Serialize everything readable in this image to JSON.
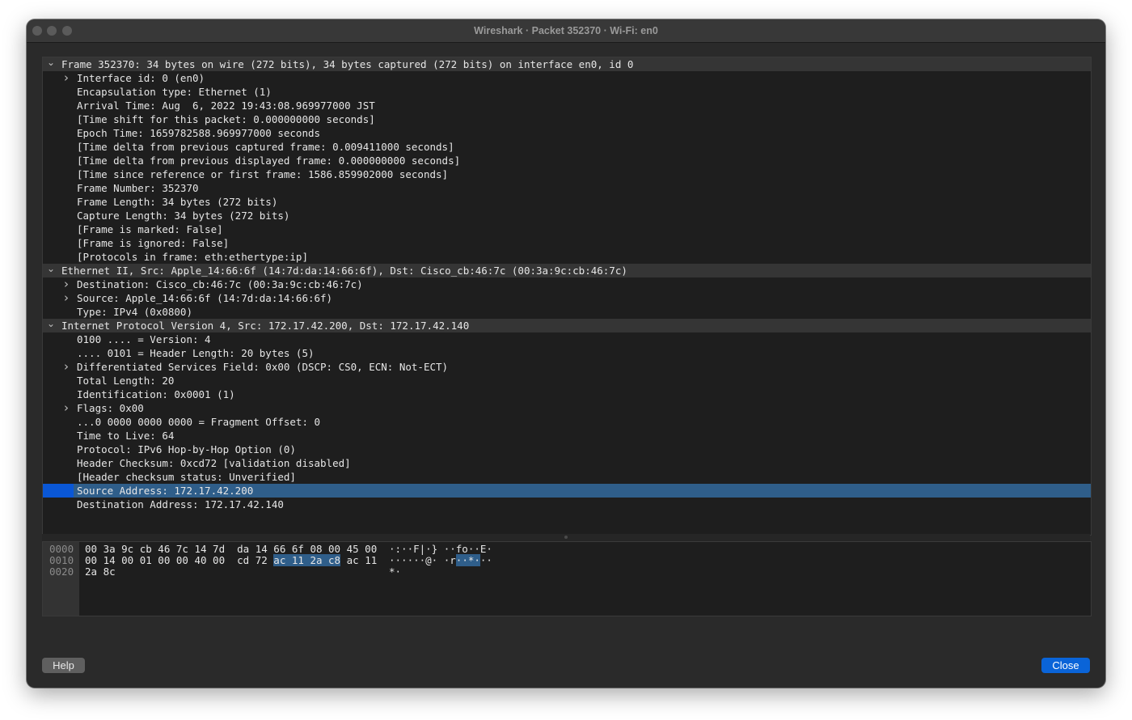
{
  "window": {
    "title": "Wireshark · Packet 352370 · Wi-Fi: en0"
  },
  "tree": {
    "rows": [
      {
        "level": 0,
        "arrow": "expanded",
        "section": true,
        "text": "Frame 352370: 34 bytes on wire (272 bits), 34 bytes captured (272 bits) on interface en0, id 0"
      },
      {
        "level": 1,
        "arrow": "collapsed",
        "text": "Interface id: 0 (en0)"
      },
      {
        "level": 1,
        "arrow": "none",
        "text": "Encapsulation type: Ethernet (1)"
      },
      {
        "level": 1,
        "arrow": "none",
        "text": "Arrival Time: Aug  6, 2022 19:43:08.969977000 JST"
      },
      {
        "level": 1,
        "arrow": "none",
        "text": "[Time shift for this packet: 0.000000000 seconds]"
      },
      {
        "level": 1,
        "arrow": "none",
        "text": "Epoch Time: 1659782588.969977000 seconds"
      },
      {
        "level": 1,
        "arrow": "none",
        "text": "[Time delta from previous captured frame: 0.009411000 seconds]"
      },
      {
        "level": 1,
        "arrow": "none",
        "text": "[Time delta from previous displayed frame: 0.000000000 seconds]"
      },
      {
        "level": 1,
        "arrow": "none",
        "text": "[Time since reference or first frame: 1586.859902000 seconds]"
      },
      {
        "level": 1,
        "arrow": "none",
        "text": "Frame Number: 352370"
      },
      {
        "level": 1,
        "arrow": "none",
        "text": "Frame Length: 34 bytes (272 bits)"
      },
      {
        "level": 1,
        "arrow": "none",
        "text": "Capture Length: 34 bytes (272 bits)"
      },
      {
        "level": 1,
        "arrow": "none",
        "text": "[Frame is marked: False]"
      },
      {
        "level": 1,
        "arrow": "none",
        "text": "[Frame is ignored: False]"
      },
      {
        "level": 1,
        "arrow": "none",
        "text": "[Protocols in frame: eth:ethertype:ip]"
      },
      {
        "level": 0,
        "arrow": "expanded",
        "section": true,
        "text": "Ethernet II, Src: Apple_14:66:6f (14:7d:da:14:66:6f), Dst: Cisco_cb:46:7c (00:3a:9c:cb:46:7c)"
      },
      {
        "level": 1,
        "arrow": "collapsed",
        "text": "Destination: Cisco_cb:46:7c (00:3a:9c:cb:46:7c)"
      },
      {
        "level": 1,
        "arrow": "collapsed",
        "text": "Source: Apple_14:66:6f (14:7d:da:14:66:6f)"
      },
      {
        "level": 1,
        "arrow": "none",
        "text": "Type: IPv4 (0x0800)"
      },
      {
        "level": 0,
        "arrow": "expanded",
        "section": true,
        "text": "Internet Protocol Version 4, Src: 172.17.42.200, Dst: 172.17.42.140"
      },
      {
        "level": 1,
        "arrow": "none",
        "text": "0100 .... = Version: 4"
      },
      {
        "level": 1,
        "arrow": "none",
        "text": ".... 0101 = Header Length: 20 bytes (5)"
      },
      {
        "level": 1,
        "arrow": "collapsed",
        "text": "Differentiated Services Field: 0x00 (DSCP: CS0, ECN: Not-ECT)"
      },
      {
        "level": 1,
        "arrow": "none",
        "text": "Total Length: 20"
      },
      {
        "level": 1,
        "arrow": "none",
        "text": "Identification: 0x0001 (1)"
      },
      {
        "level": 1,
        "arrow": "collapsed",
        "text": "Flags: 0x00"
      },
      {
        "level": 1,
        "arrow": "none",
        "text": "...0 0000 0000 0000 = Fragment Offset: 0"
      },
      {
        "level": 1,
        "arrow": "none",
        "text": "Time to Live: 64"
      },
      {
        "level": 1,
        "arrow": "none",
        "text": "Protocol: IPv6 Hop-by-Hop Option (0)"
      },
      {
        "level": 1,
        "arrow": "none",
        "text": "Header Checksum: 0xcd72 [validation disabled]"
      },
      {
        "level": 1,
        "arrow": "none",
        "text": "[Header checksum status: Unverified]"
      },
      {
        "level": 1,
        "arrow": "none",
        "selected": true,
        "text": "Source Address: 172.17.42.200"
      },
      {
        "level": 1,
        "arrow": "none",
        "text": "Destination Address: 172.17.42.140"
      }
    ]
  },
  "bytes": {
    "rows": [
      {
        "offset": "0000",
        "hex_a": "00 3a 9c cb 46 7c 14 7d  da 14 66 6f 08 00 45 00",
        "hex_hl": "",
        "hex_b": "",
        "ascii_a": "·:··F|·} ··fo··E·",
        "ascii_hl": "",
        "ascii_b": ""
      },
      {
        "offset": "0010",
        "hex_a": "00 14 00 01 00 00 40 00  cd 72 ",
        "hex_hl": "ac 11 2a c8",
        "hex_b": " ac 11",
        "ascii_a": "······@· ·r",
        "ascii_hl": "··*·",
        "ascii_b": "··"
      },
      {
        "offset": "0020",
        "hex_a": "2a 8c",
        "hex_hl": "",
        "hex_b": "",
        "ascii_a": "*·",
        "ascii_hl": "",
        "ascii_b": ""
      }
    ]
  },
  "buttons": {
    "help": "Help",
    "close": "Close"
  },
  "colors": {
    "accent": "#0a64d8",
    "selection": "#2f5e8a",
    "section_row": "#353535"
  }
}
